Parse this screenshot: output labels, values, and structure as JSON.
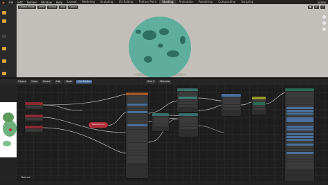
{
  "topbar": {
    "menus": [
      "File",
      "Edit",
      "Render",
      "Window",
      "Help"
    ],
    "workspace_tabs": [
      "Layout",
      "Modeling",
      "Sculpting",
      "UV Editing",
      "Texture Paint",
      "Shading",
      "Animation",
      "Rendering",
      "Compositing",
      "Scripting"
    ],
    "active_tab": "Shading",
    "scene": "Scene"
  },
  "viewport": {
    "mode": "Object Mode",
    "menus": [
      "View",
      "Select",
      "Add",
      "Object"
    ],
    "background": "#c2bfba",
    "sphere_color": "#5fae9c",
    "spot_color": "#2f6f60"
  },
  "node_editor": {
    "header": {
      "menus": [
        "Object",
        "View",
        "Select",
        "Add",
        "Node"
      ],
      "use_nodes": "Use Nodes",
      "slot": "Slot 1",
      "material": "Material"
    },
    "footer_label": "Material",
    "frame_node_label": "Separate Color"
  },
  "colors": {
    "accent": "#e07a34",
    "header_bg": "#232323",
    "node_bg": "#2f2f2f"
  }
}
